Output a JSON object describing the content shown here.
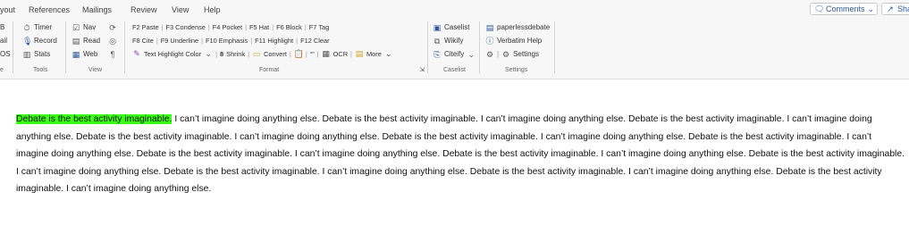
{
  "tabs": [
    "yout",
    "References",
    "Mailings",
    "Review",
    "View",
    "Help"
  ],
  "right_buttons": {
    "comments": "Comments",
    "share": "Sha"
  },
  "left_stub": {
    "items": [
      "B",
      "ail",
      "OS"
    ],
    "group": "e"
  },
  "tools": {
    "items": [
      "Timer",
      "Record",
      "Stats"
    ],
    "group": "Tools"
  },
  "view": {
    "items": [
      "Nav",
      "Read",
      "Web"
    ],
    "group": "View"
  },
  "format": {
    "row1": [
      "F2 Paste",
      "F3 Condense",
      "F4 Pocket",
      "F5 Hat",
      "F6 Block",
      "F7 Tag"
    ],
    "row2": [
      "F8 Cite",
      "F9 Underline",
      "F10 Emphasis",
      "F11 Highlight",
      "F12 Clear"
    ],
    "row3": {
      "highlight": "Text Highlight Color",
      "shrink_num": "8",
      "shrink": "Shrink",
      "convert": "Convert",
      "quote": "“”",
      "ocr": "OCR",
      "more": "More"
    },
    "group": "Format"
  },
  "caselist": {
    "items": [
      "Caselist",
      "Wikify",
      "Citeify"
    ],
    "group": "Caselist"
  },
  "settings": {
    "items": [
      "paperlessdebate",
      "Verbatim Help",
      "Settings"
    ],
    "group": "Settings"
  },
  "document": {
    "highlighted": "Debate is the best activity imaginable.",
    "body": " I can’t imagine doing anything else. Debate is the best activity imaginable. I can’t imagine doing anything else. Debate is the best activity imaginable. I can’t imagine doing anything else. Debate is the best activity imaginable. I can’t imagine doing anything else. Debate is the best activity imaginable. I can’t imagine doing anything else. Debate is the best activity imaginable. I can’t imagine doing anything else. Debate is the best activity imaginable. I can’t imagine doing anything else. Debate is the best activity imaginable. I can’t imagine doing anything else. Debate is the best activity imaginable. I can’t imagine doing anything else. Debate is the best activity imaginable. I can’t imagine doing anything else. Debate is the best activity imaginable. I can’t imagine doing anything else. Debate is the best activity imaginable. I can’t imagine doing anything else."
  },
  "colors": {
    "highlight": "#39ff14",
    "accent": "#2b579a",
    "ribbon_bg": "#f7f7f7"
  }
}
